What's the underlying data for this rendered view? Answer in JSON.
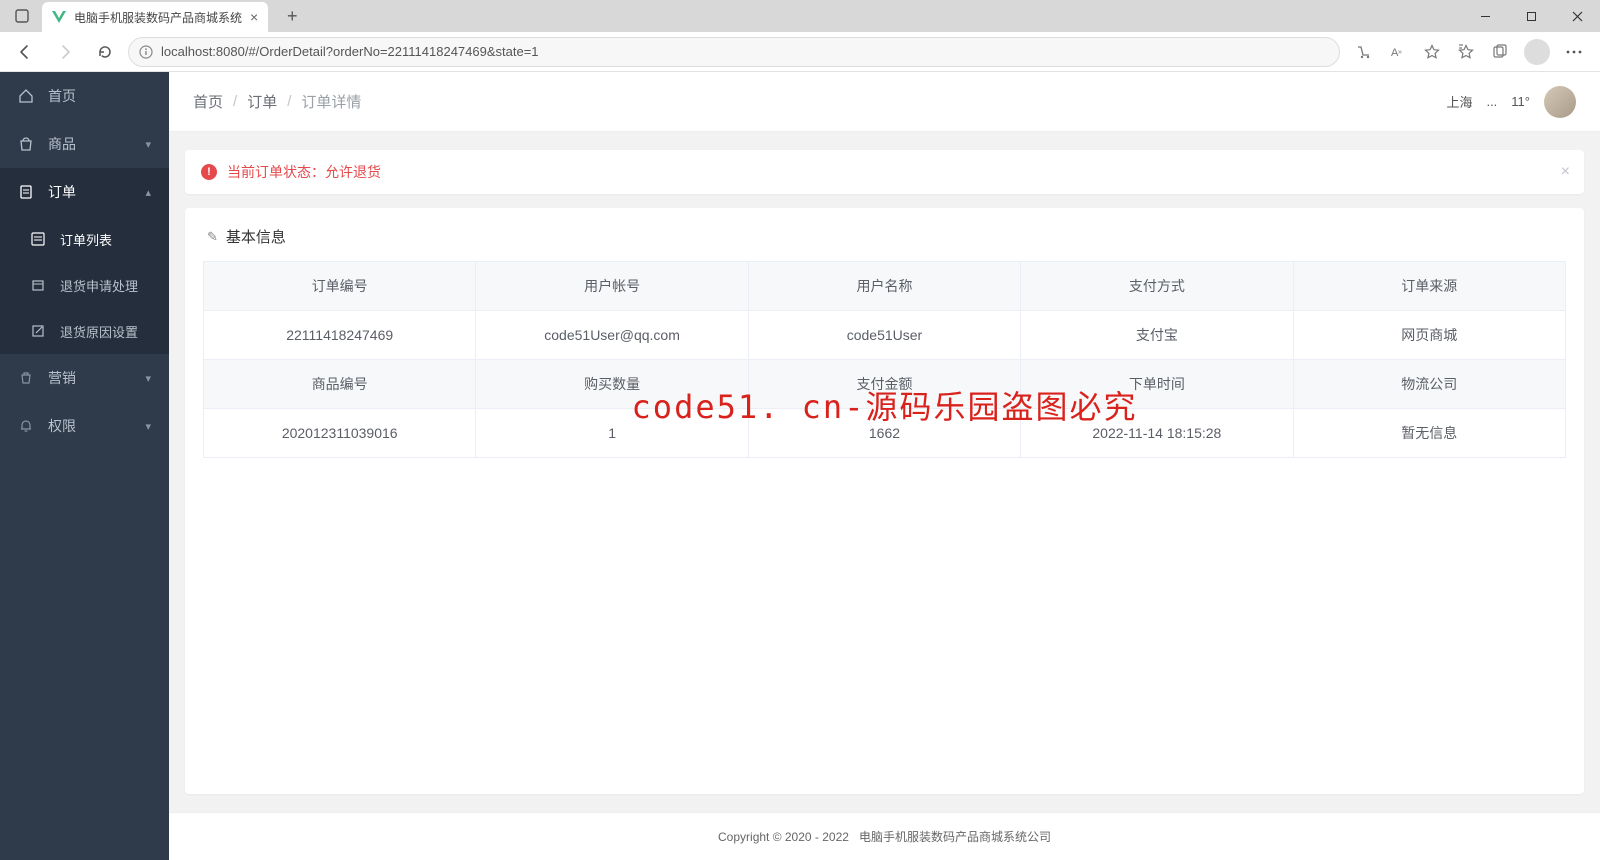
{
  "browser": {
    "tab_title": "电脑手机服装数码产品商城系统",
    "url": "localhost:8080/#/OrderDetail?orderNo=22111418247469&state=1"
  },
  "sidebar": {
    "items": [
      {
        "icon": "home",
        "label": "首页"
      },
      {
        "icon": "bag",
        "label": "商品",
        "chev": true
      },
      {
        "icon": "clipboard",
        "label": "订单",
        "chev": true,
        "expanded": true
      },
      {
        "icon": "gear",
        "label": "营销",
        "chev": true
      },
      {
        "icon": "bell",
        "label": "权限",
        "chev": true
      }
    ],
    "order_sub": [
      {
        "icon": "list",
        "label": "订单列表",
        "selected": true
      },
      {
        "icon": "box",
        "label": "退货申请处理"
      },
      {
        "icon": "edit",
        "label": "退货原因设置"
      }
    ]
  },
  "breadcrumb": {
    "home": "首页",
    "order": "订单",
    "current": "订单详情"
  },
  "topbar": {
    "city": "上海",
    "temp": "11°"
  },
  "alert": {
    "text": "当前订单状态：允许退货"
  },
  "panel": {
    "title": "基本信息"
  },
  "table": {
    "row1_headers": [
      "订单编号",
      "用户帐号",
      "用户名称",
      "支付方式",
      "订单来源"
    ],
    "row1_values": [
      "22111418247469",
      "code51User@qq.com",
      "code51User",
      "支付宝",
      "网页商城"
    ],
    "row2_headers": [
      "商品编号",
      "购买数量",
      "支付金额",
      "下单时间",
      "物流公司"
    ],
    "row2_values": [
      "202012311039016",
      "1",
      "1662",
      "2022-11-14 18:15:28",
      "暂无信息"
    ]
  },
  "footer": {
    "copyright": "Copyright © 2020 - 2022",
    "company": "电脑手机服装数码产品商城系统公司"
  },
  "watermark": "code51. cn-源码乐园盗图必究"
}
